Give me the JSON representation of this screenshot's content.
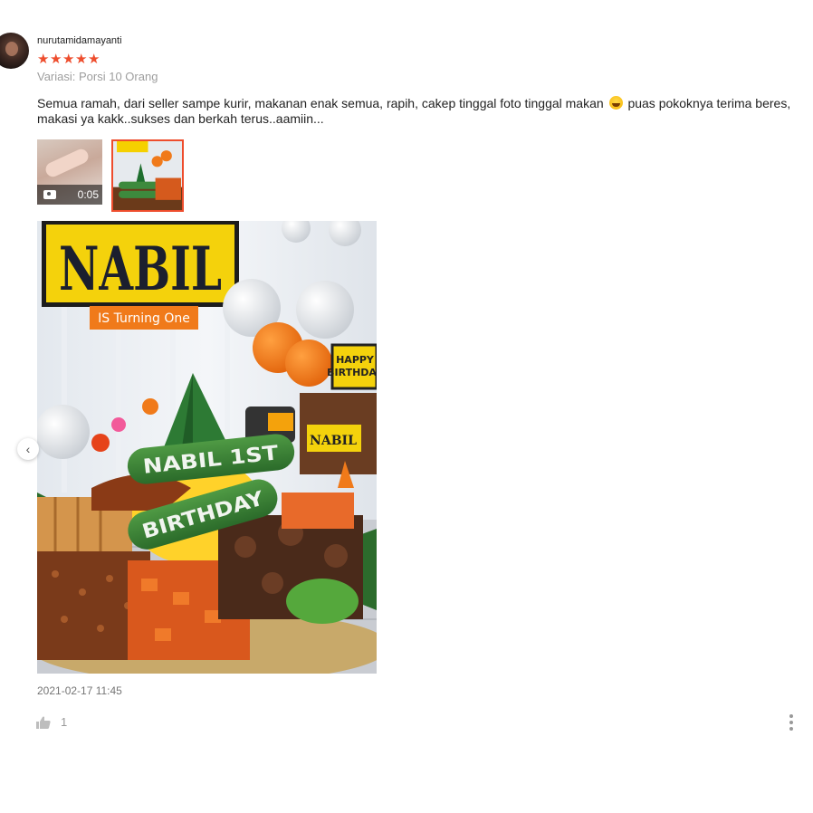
{
  "review": {
    "username": "nurutamidamayanti",
    "rating": 5,
    "variant": "Variasi: Porsi 10 Orang",
    "comment_part1": "Semua ramah, dari seller sampe kurir, makanan enak semua, rapih, cakep tinggal foto tinggal makan",
    "comment_part2": " puas pokoknya terima beres, makasi ya kakk..sukses dan berkah terus..aamiin...",
    "emoji": "rofl-emoji",
    "date": "2021-02-17 11:45",
    "likes": "1"
  },
  "media": {
    "video_duration": "0:05",
    "photo_text": {
      "banner_name": "NABIL",
      "banner_sub": "IS Turning One",
      "sign_happy": "HAPPY",
      "sign_birthday": "BIRTHDAY",
      "cake_name": "NABIL",
      "cucumber_line1": "NABIL 1ST",
      "cucumber_line2": "BIRTHDAY"
    }
  },
  "icons": {
    "star": "star-icon",
    "video": "video-camera-icon",
    "prev": "chevron-left-icon",
    "like": "thumbs-up-icon",
    "more": "more-vertical-icon"
  },
  "colors": {
    "accent": "#ee4d2d",
    "muted": "#9e9e9e"
  }
}
